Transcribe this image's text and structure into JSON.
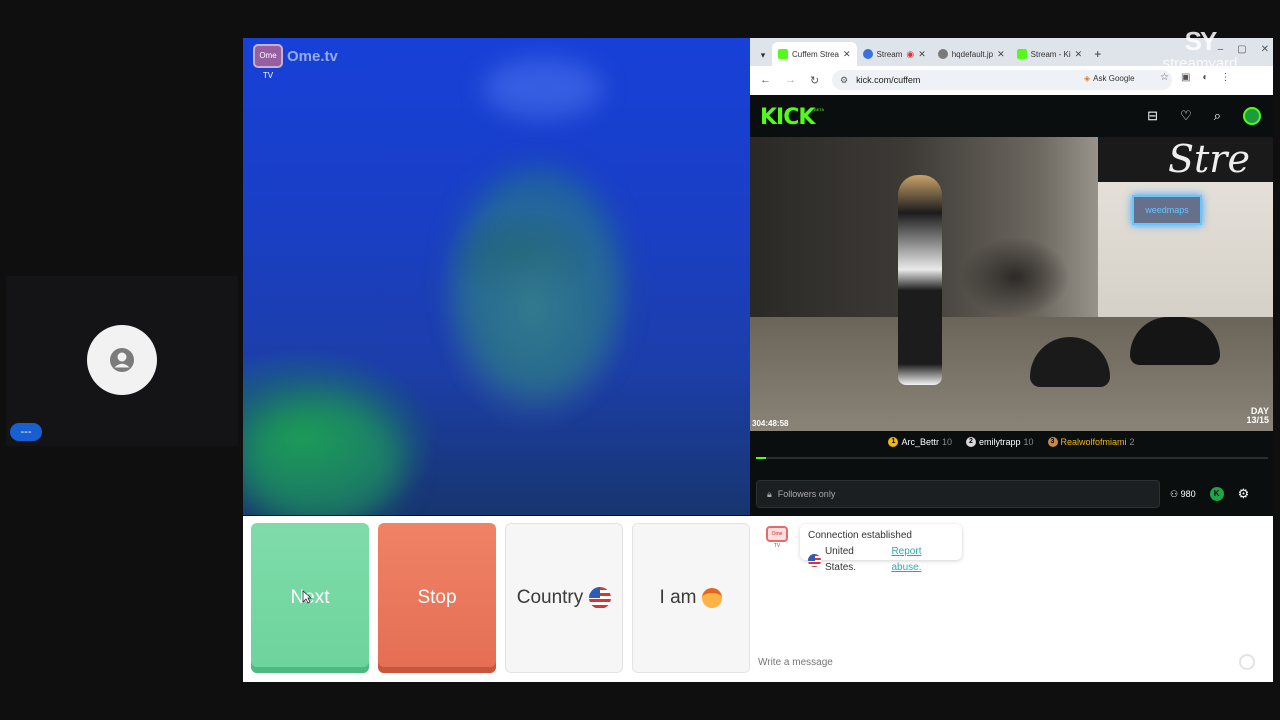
{
  "participant": {
    "name_badge": "---"
  },
  "ome": {
    "logo_icon_text": "Ome TV",
    "logo_text": "Ome.tv"
  },
  "browser": {
    "tabs": [
      {
        "label": "Cuffem Strea",
        "favicon_color": "#53fc18",
        "active": true
      },
      {
        "label": "Stream",
        "favicon_color": "#3b6fe0",
        "active": false
      },
      {
        "label": "hqdefault.jp",
        "favicon_color": "#7a7a7a",
        "active": false
      },
      {
        "label": "Stream - Ki",
        "favicon_color": "#53fc18",
        "active": false
      }
    ],
    "url": "kick.com/cuffem",
    "ask_google": "Ask Google"
  },
  "kick": {
    "logo": "KICK",
    "logo_beta": "BETA",
    "stream_sign": "Stre",
    "neon_sign": "weedmaps",
    "timer": "304:48:58",
    "day_label": "DAY",
    "day_value": "13/15",
    "gifters": [
      {
        "rank": "1",
        "rank_color": "#f0b90b",
        "name": "Arc_Bettr",
        "count": "10",
        "name_color": "#ffffff"
      },
      {
        "rank": "2",
        "rank_color": "#d8d8d8",
        "name": "emilytrapp",
        "count": "10",
        "name_color": "#ffffff"
      },
      {
        "rank": "3",
        "rank_color": "#c8884a",
        "name": "Realwolfofmiami",
        "count": "2",
        "name_color": "#f0b90b"
      }
    ],
    "goal_progress_percent": 2,
    "chat_placeholder": "Followers only",
    "viewer_count": "980"
  },
  "watermark": {
    "logo": "SY",
    "text": "streamyard"
  },
  "controls": {
    "next": "Next",
    "stop": "Stop",
    "country": "Country",
    "i_am": "I am"
  },
  "chat": {
    "logo_text": "Ome TV",
    "connection": "Connection established",
    "country": "United States.",
    "report": "Report abuse.",
    "input_placeholder": "Write a message"
  }
}
